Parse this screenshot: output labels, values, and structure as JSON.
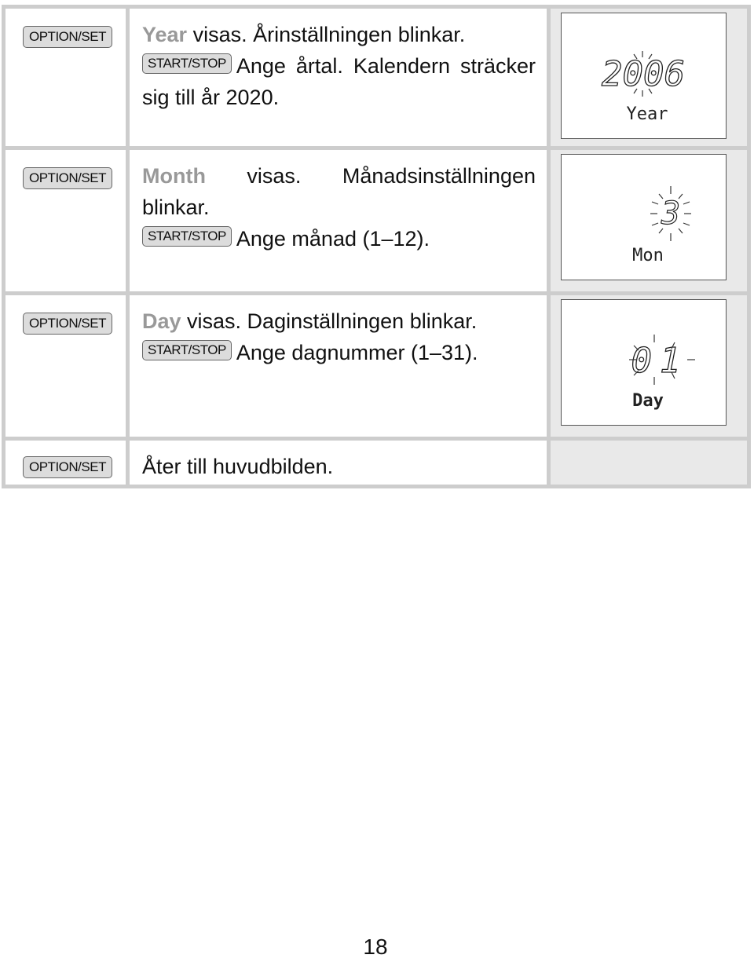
{
  "rows": [
    {
      "key": "OPTION/SET",
      "highlight": "Year",
      "line1_rest": " visas. Årinställningen blinkar.",
      "start_key": "START/STOP",
      "line2": "Ange årtal. Kalendern sträcker sig till år 2020.",
      "lcd": {
        "digits": "2006",
        "label": "Year"
      }
    },
    {
      "key": "OPTION/SET",
      "highlight": "Month",
      "line1_rest": " visas. Månadsinställningen blinkar.",
      "start_key": "START/STOP",
      "line2": "Ange månad (1–12).",
      "lcd": {
        "digits": "3",
        "label": "Mon"
      }
    },
    {
      "key": "OPTION/SET",
      "highlight": "Day",
      "line1_rest": " visas. Daginställningen blinkar.",
      "start_key": "START/STOP",
      "line2": "Ange dagnummer (1–31).",
      "lcd": {
        "digits": "01",
        "label": "Day"
      }
    },
    {
      "key": "OPTION/SET",
      "text": "Åter till huvudbilden."
    }
  ],
  "page_number": "18"
}
